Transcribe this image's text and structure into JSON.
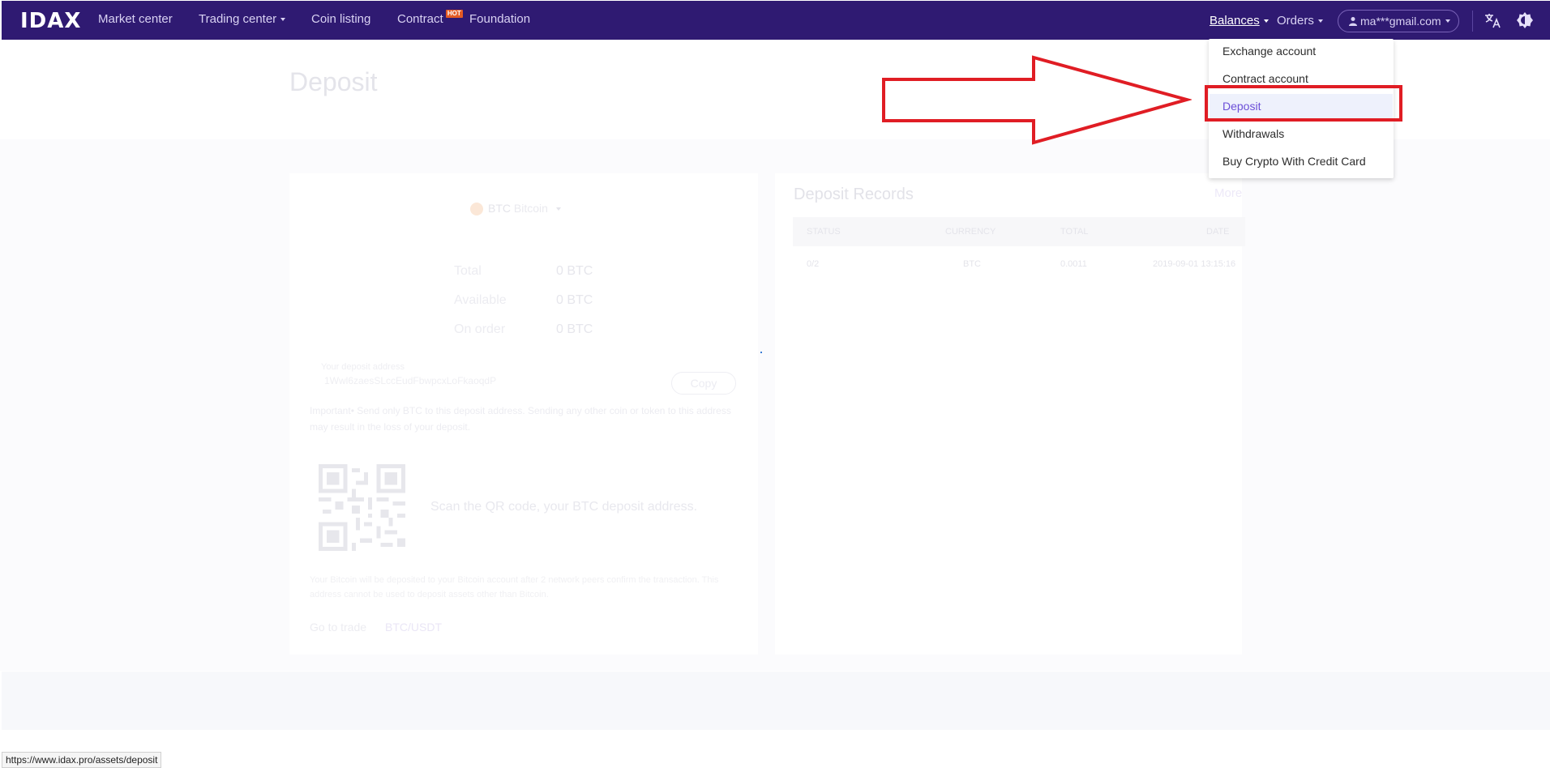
{
  "nav": {
    "logo": "IDAX",
    "items": [
      {
        "label": "Market center"
      },
      {
        "label": "Trading center"
      },
      {
        "label": "Coin listing"
      },
      {
        "label": "Contract",
        "badge": "HOT"
      },
      {
        "label": "Foundation"
      }
    ],
    "balances": "Balances",
    "orders": "Orders",
    "user": "ma***gmail.com",
    "icons": [
      "translate-icon",
      "theme-icon"
    ]
  },
  "page": {
    "title": "Deposit",
    "coin": {
      "symbol": "BTC",
      "name": "Bitcoin"
    },
    "balances": [
      {
        "label": "Total",
        "value": "0 BTC"
      },
      {
        "label": "Available",
        "value": "0 BTC"
      },
      {
        "label": "On order",
        "value": "0 BTC"
      }
    ],
    "address_label": "Your deposit address",
    "address_value": "1Wwl6zaesSLccEudFbwpcxLoFkaoqdP",
    "copy_label": "Copy",
    "notice": "Important• Send only BTC to this deposit address. Sending any other coin or token to this address may result in the loss of your deposit.",
    "scan_text": "Scan the QR code, your BTC deposit address.",
    "footnote": "Your Bitcoin will be deposited to your Bitcoin account after 2 network peers confirm the transaction. This address cannot be used to deposit assets other than Bitcoin.",
    "goto_label": "Go to trade",
    "goto_pair": "BTC/USDT"
  },
  "records": {
    "title": "Deposit Records",
    "more": "More",
    "headers": [
      "STATUS",
      "CURRENCY",
      "TOTAL",
      "DATE"
    ],
    "rows": [
      {
        "status": "0/2",
        "currency": "BTC",
        "total": "0.0011",
        "date": "2019-09-01 13:15:16"
      }
    ]
  },
  "dropdown": {
    "items": [
      "Exchange account",
      "Contract account",
      "Deposit",
      "Withdrawals",
      "Buy Crypto With Credit Card"
    ],
    "selected": "Deposit"
  },
  "status_url": "https://www.idax.pro/assets/deposit",
  "colors": {
    "nav_bg": "#2f1a72",
    "accent": "#6c4fd8",
    "annotation_red": "#e01d24"
  }
}
